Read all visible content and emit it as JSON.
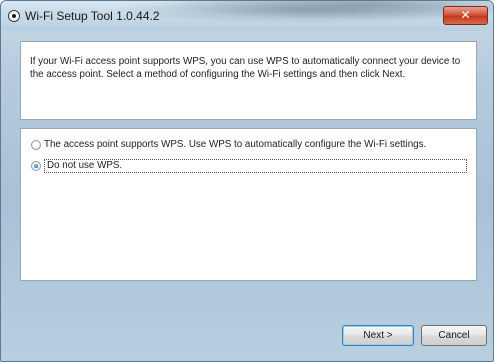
{
  "window": {
    "title": "Wi-Fi Setup Tool 1.0.44.2",
    "close_glyph": "✕",
    "icon": "app-radio-icon"
  },
  "intro": {
    "text": "If your Wi-Fi access point supports WPS, you can use WPS to automatically connect your device to the access point. Select a method of configuring the Wi-Fi settings and then click Next."
  },
  "options": [
    {
      "label": "The access point supports WPS. Use WPS to automatically configure the Wi-Fi settings.",
      "selected": false
    },
    {
      "label": "Do not use WPS.",
      "selected": true
    }
  ],
  "buttons": {
    "next_label": "Next >",
    "cancel_label": "Cancel"
  },
  "colors": {
    "close_button": "#c23a1f",
    "radio_selected": "#2a6fbf",
    "default_button_border": "#3c7fb1"
  }
}
